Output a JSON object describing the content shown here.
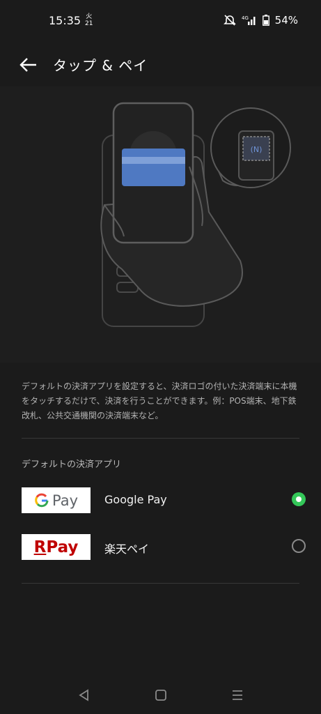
{
  "status_bar": {
    "time": "15:35",
    "calendar_top": "火",
    "calendar_day": "21",
    "battery": "54%"
  },
  "header": {
    "title": "タップ & ペイ"
  },
  "description": "デフォルトの決済アプリを設定すると、決済ロゴの付いた決済端末に本機をタッチするだけで、決済を行うことができます。例：POS端末、地下鉄改札、公共交通機関の決済端末など。",
  "section_title": "デフォルトの決済アプリ",
  "apps": [
    {
      "name": "Google Pay",
      "logo_text": "Pay",
      "selected": true
    },
    {
      "name": "楽天ペイ",
      "logo_text": "Pay",
      "logo_mark": "R",
      "selected": false
    }
  ],
  "colors": {
    "background": "#1b1b1b",
    "radio_selected": "#34c759",
    "rakuten_red": "#bf0000",
    "card_blue": "#4f79c2"
  },
  "icons": [
    "back-arrow-icon",
    "mute-icon",
    "signal-icon",
    "battery-icon",
    "nfc-icon",
    "nav-back-icon",
    "nav-home-icon",
    "nav-recents-icon"
  ]
}
